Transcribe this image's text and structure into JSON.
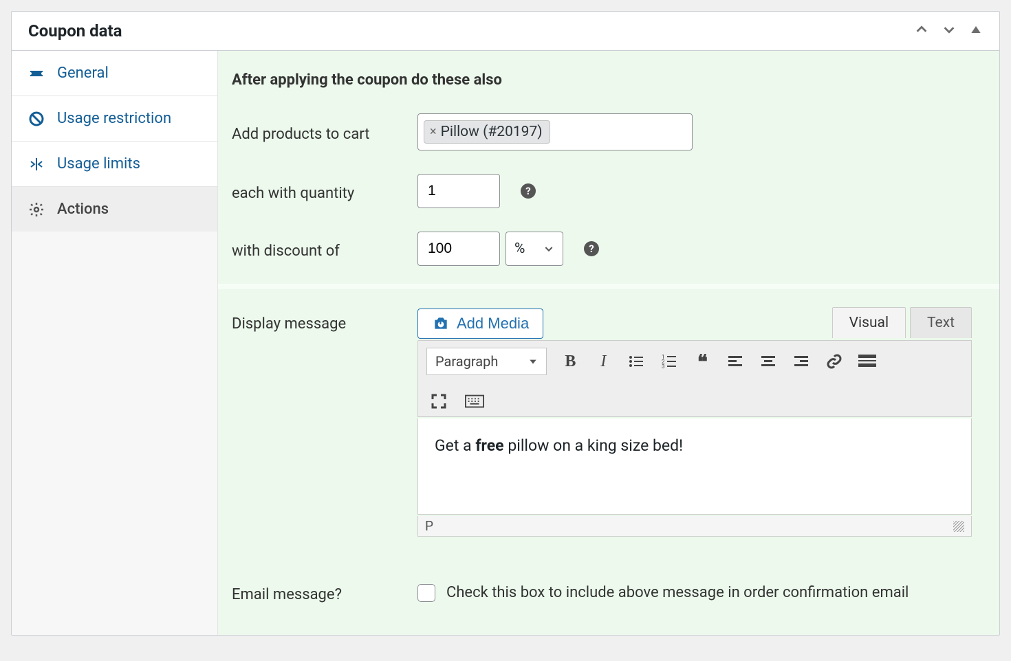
{
  "panel": {
    "title": "Coupon data"
  },
  "tabs": [
    {
      "icon": "ticket",
      "label": "General"
    },
    {
      "icon": "ban",
      "label": "Usage restriction"
    },
    {
      "icon": "merge",
      "label": "Usage limits"
    },
    {
      "icon": "gear",
      "label": "Actions",
      "active": true
    }
  ],
  "actions": {
    "heading": "After applying the coupon do these also",
    "add_products_label": "Add products to cart",
    "product_chip": "Pillow (#20197)",
    "quantity_label": "each with quantity",
    "quantity_value": "1",
    "discount_label": "with discount of",
    "discount_value": "100",
    "discount_unit": "%",
    "display_message_label": "Display message",
    "add_media_label": "Add Media",
    "editor_tabs": {
      "visual": "Visual",
      "text": "Text"
    },
    "format_select": "Paragraph",
    "message_pre": "Get a ",
    "message_bold": "free",
    "message_post": " pillow on a king size bed!",
    "status_tag": "P",
    "email_label": "Email message?",
    "email_checkbox_text": "Check this box to include above message in order confirmation email"
  }
}
